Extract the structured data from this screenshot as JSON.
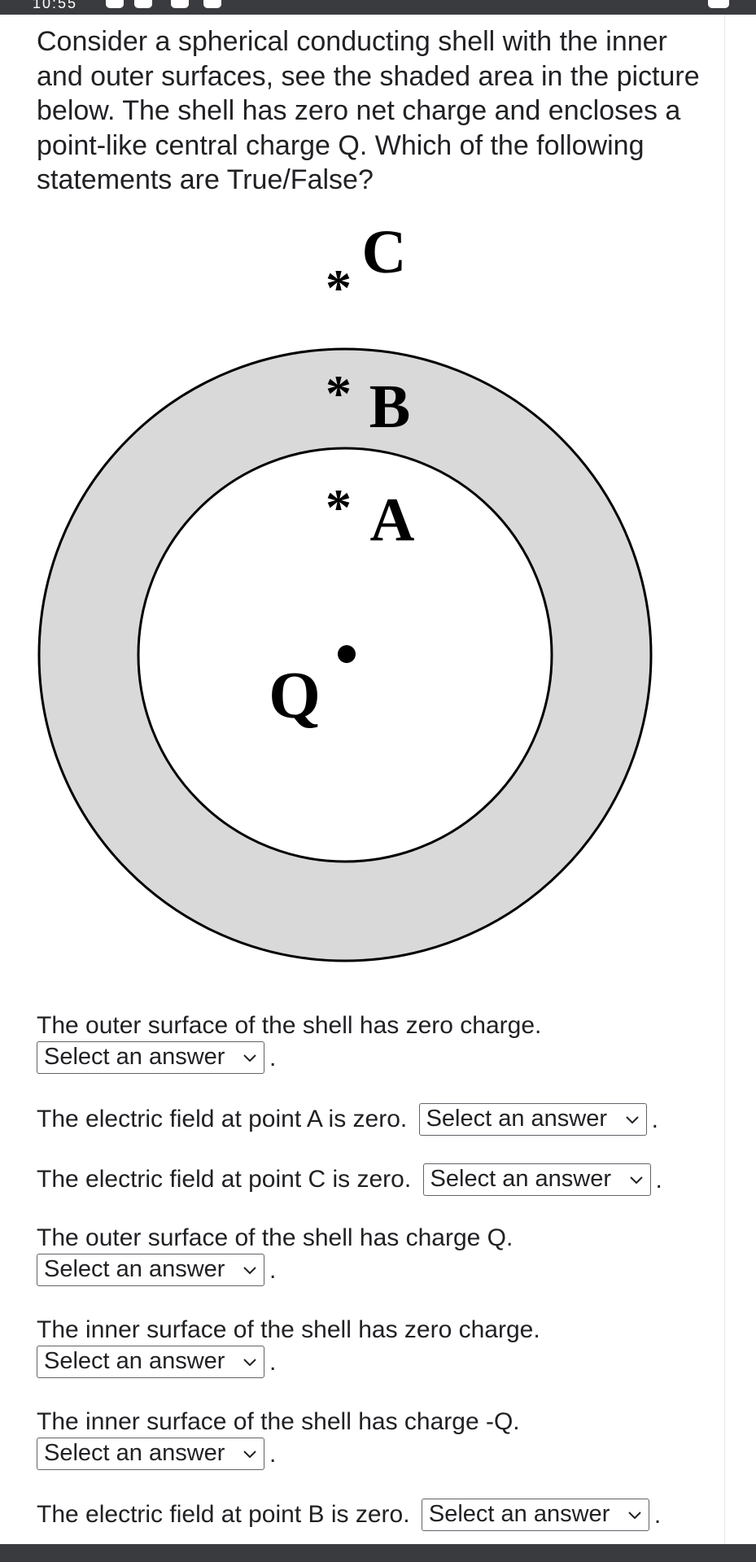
{
  "status_bar": {
    "time": "10:55"
  },
  "question": {
    "text": "Consider a spherical conducting shell with the inner and outer surfaces, see the shaded area in the picture below. The shell has zero net charge and encloses a point-like central charge Q. Which of the following statements are True/False?"
  },
  "figure": {
    "labels": {
      "c": "C",
      "b": "B",
      "a": "A",
      "q": "Q"
    },
    "marker": "*",
    "colors": {
      "shell_fill": "#d9d9d9",
      "stroke": "#000000"
    }
  },
  "statements": [
    {
      "text": "The outer surface of the shell has zero charge.",
      "select_value": "Select an answer"
    },
    {
      "text": "The electric field at point A is zero.",
      "select_value": "Select an answer"
    },
    {
      "text": "The electric field at point C is zero.",
      "select_value": "Select an answer"
    },
    {
      "text": "The outer surface of the shell has charge Q.",
      "select_value": "Select an answer"
    },
    {
      "text": "The inner surface of the shell has zero charge.",
      "select_value": "Select an answer"
    },
    {
      "text": "The inner surface of the shell has charge -Q.",
      "select_value": "Select an answer"
    },
    {
      "text": "The electric field at point B is zero.",
      "select_value": "Select an answer"
    }
  ],
  "period": "."
}
